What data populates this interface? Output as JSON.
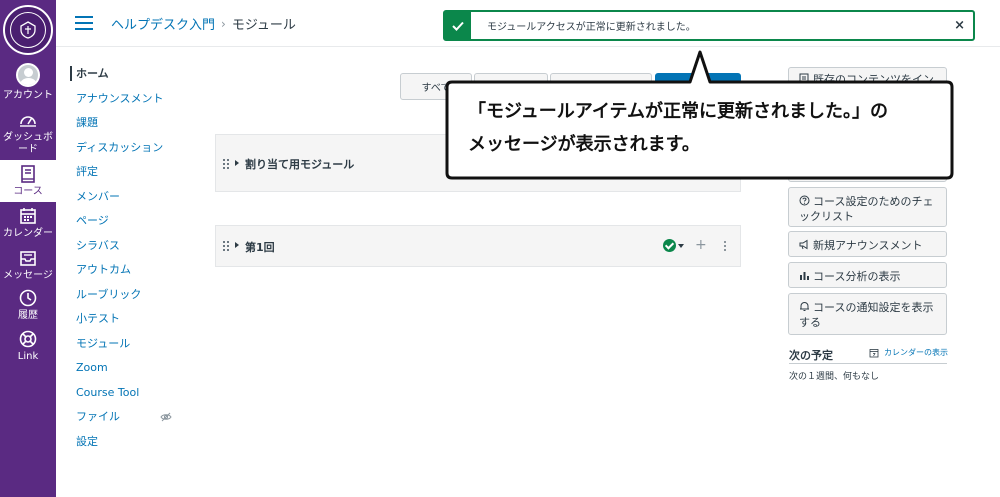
{
  "global_nav": {
    "logo_text": "RIKKYO UNIVERSITY",
    "items": [
      {
        "label": "アカウント"
      },
      {
        "label": "ダッシュボード"
      },
      {
        "label": "コース"
      },
      {
        "label": "カレンダー"
      },
      {
        "label": "メッセージ"
      },
      {
        "label": "履歴"
      },
      {
        "label": "Link"
      }
    ]
  },
  "breadcrumb": {
    "course": "ヘルプデスク入門",
    "separator": "›",
    "current": "モジュール"
  },
  "course_nav": [
    "ホーム",
    "アナウンスメント",
    "課題",
    "ディスカッション",
    "評定",
    "メンバー",
    "ページ",
    "シラバス",
    "アウトカム",
    "ルーブリック",
    "小テスト",
    "モジュール",
    "Zoom",
    "Course Tool",
    "ファイル",
    "設定"
  ],
  "toolbar": {
    "view_all_label": "すべて"
  },
  "modules": [
    {
      "title": "割り当て用モジュール"
    },
    {
      "title": "第1回"
    }
  ],
  "sidebar": {
    "buttons": [
      {
        "label": "既存のコンテンツをイン"
      },
      {
        "label": "コース設定のためのチェックリスト"
      },
      {
        "label": "新規アナウンスメント"
      },
      {
        "label": "コース分析の表示"
      },
      {
        "label": "コースの通知設定を表示する"
      }
    ],
    "todo": {
      "title": "次の予定",
      "calendar_link": "カレンダーの表示",
      "empty_text": "次の１週間、何もなし"
    }
  },
  "flash": {
    "message": "モジュールアクセスが正常に更新されました。",
    "close": "×"
  },
  "callout": {
    "line1": "「モジュールアイテムが正常に更新されました。」の",
    "line2": "メッセージが表示されます。"
  },
  "colors": {
    "nav_purple": "#5a2a82",
    "link_blue": "#0374b5",
    "success_green": "#0b874b"
  }
}
